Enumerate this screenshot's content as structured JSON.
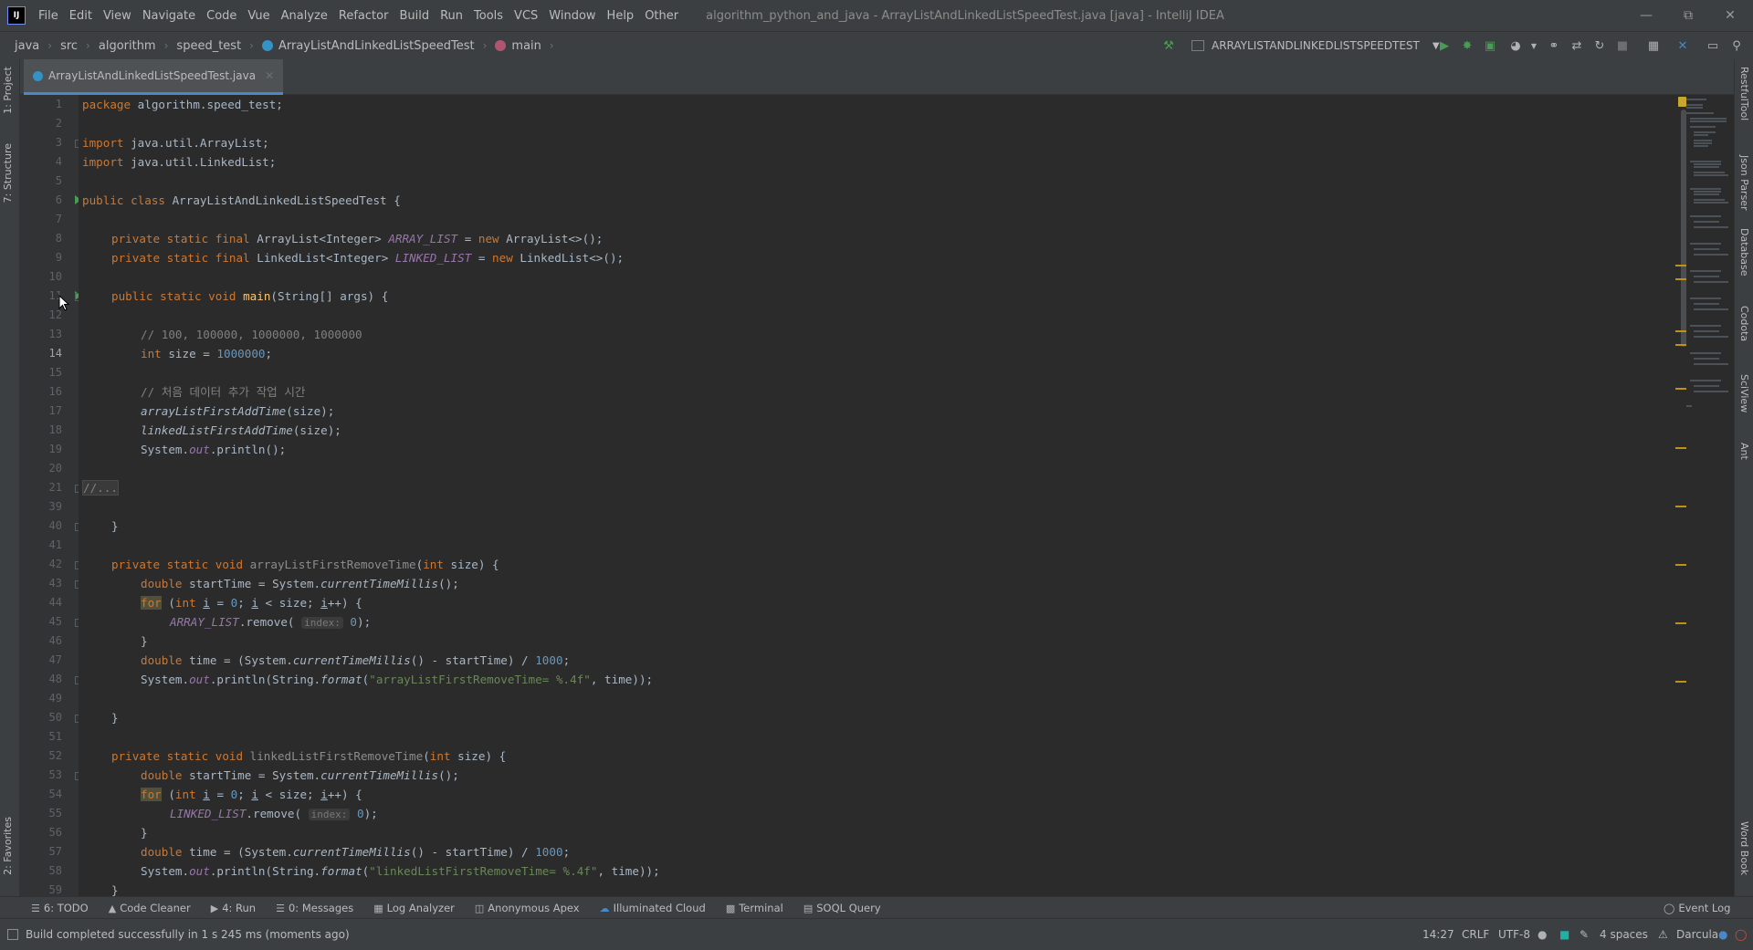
{
  "menubar": {
    "logo": "IJ",
    "items": [
      "File",
      "Edit",
      "View",
      "Navigate",
      "Code",
      "Vue",
      "Analyze",
      "Refactor",
      "Build",
      "Run",
      "Tools",
      "VCS",
      "Window",
      "Help",
      "Other"
    ],
    "window_title": "algorithm_python_and_java - ArrayListAndLinkedListSpeedTest.java [java] - IntelliJ IDEA"
  },
  "breadcrumb": {
    "items": [
      "java",
      "src",
      "algorithm",
      "speed_test",
      "ArrayListAndLinkedListSpeedTest",
      "main"
    ]
  },
  "toolbar": {
    "run_config": "ARRAYLISTANDLINKEDLISTSPEEDTEST"
  },
  "left_tabs": {
    "project": "1: Project",
    "structure": "7: Structure",
    "favorites": "2: Favorites"
  },
  "right_tabs": {
    "restful": "RestfulTool",
    "json_parser": "Json Parser",
    "database": "Database",
    "codota": "Codota",
    "sciview": "SciView",
    "ant": "Ant",
    "wordbook": "Word Book"
  },
  "editor": {
    "tab_name": "ArrayListAndLinkedListSpeedTest.java",
    "current_line": 14,
    "line_numbers": [
      "1",
      "2",
      "3",
      "4",
      "5",
      "6",
      "7",
      "8",
      "9",
      "10",
      "11",
      "12",
      "13",
      "14",
      "15",
      "16",
      "17",
      "18",
      "19",
      "20",
      "21",
      "39",
      "40",
      "41",
      "42",
      "43",
      "44",
      "45",
      "46",
      "47",
      "48",
      "49",
      "50",
      "51",
      "52",
      "53",
      "54",
      "55",
      "56",
      "57",
      "58",
      "59"
    ],
    "code": {
      "l1_kw": "package",
      "l1": " algorithm.speed_test;",
      "l3_kw": "import",
      "l3": " java.util.ArrayList;",
      "l4_kw": "import",
      "l4": " java.util.LinkedList;",
      "l6_kw": "public class",
      "l6": " ArrayListAndLinkedListSpeedTest {",
      "l8_kw": "private static final",
      "l8_type": " ArrayList<Integer> ",
      "l8_field": "ARRAY_LIST",
      "l8_eq": " = ",
      "l8_new": "new",
      "l8_rest": " ArrayList<>();",
      "l9_kw": "private static final",
      "l9_type": " LinkedList<Integer> ",
      "l9_field": "LINKED_LIST",
      "l9_eq": " = ",
      "l9_new": "new",
      "l9_rest": " LinkedList<>();",
      "l11_kw": "public static void",
      "l11_name": " main",
      "l11_rest": "(String[] args) {",
      "l13": "// 100, 100000, 1000000, 1000000",
      "l14_kw": "int",
      "l14": " size = ",
      "l14_num": "1000000",
      "l14_end": ";",
      "l16": "// 처음 데이터 추가 작업 시간",
      "l17": "arrayListFirstAddTime",
      "l17_rest": "(size);",
      "l18": "linkedListFirstAddTime",
      "l18_rest": "(size);",
      "l19_a": "System.",
      "l19_out": "out",
      "l19_b": ".println();",
      "l21": "//...",
      "l40": "}",
      "l42_kw": "private static void",
      "l42_name": " arrayListFirstRemoveTime",
      "l42_p": "(",
      "l42_int": "int",
      "l42_rest": " size) {",
      "l43_kw": "double",
      "l43_a": " startTime = System.",
      "l43_m": "currentTimeMillis",
      "l43_b": "();",
      "l44_for": "for",
      "l44_a": " (",
      "l44_int": "int",
      "l44_b": " ",
      "l44_i": "i",
      "l44_c": " = ",
      "l44_zero": "0",
      "l44_d": "; ",
      "l44_i2": "i",
      "l44_e": " < size; ",
      "l44_i3": "i",
      "l44_f": "++) {",
      "l45_field": "ARRAY_LIST",
      "l45_a": ".remove( ",
      "l45_hint": "index:",
      "l45_num": " 0",
      "l45_b": ");",
      "l46": "}",
      "l47_kw": "double",
      "l47_a": " time = (System.",
      "l47_m": "currentTimeMillis",
      "l47_b": "() - startTime) / ",
      "l47_num": "1000",
      "l47_c": ";",
      "l48_a": "System.",
      "l48_out": "out",
      "l48_b": ".println(String.",
      "l48_f": "format",
      "l48_c": "(",
      "l48_str": "\"arrayListFirstRemoveTime= %.4f\"",
      "l48_d": ", time));",
      "l50": "}",
      "l52_kw": "private static void",
      "l52_name": " linkedListFirstRemoveTime",
      "l52_p": "(",
      "l52_int": "int",
      "l52_rest": " size) {",
      "l53_kw": "double",
      "l53_a": " startTime = System.",
      "l53_m": "currentTimeMillis",
      "l53_b": "();",
      "l54_for": "for",
      "l54_a": " (",
      "l54_int": "int",
      "l54_b": " ",
      "l54_i": "i",
      "l54_c": " = ",
      "l54_zero": "0",
      "l54_d": "; ",
      "l54_i2": "i",
      "l54_e": " < size; ",
      "l54_i3": "i",
      "l54_f": "++) {",
      "l55_field": "LINKED_LIST",
      "l55_a": ".remove( ",
      "l55_hint": "index:",
      "l55_num": " 0",
      "l55_b": ");",
      "l56": "}",
      "l57_kw": "double",
      "l57_a": " time = (System.",
      "l57_m": "currentTimeMillis",
      "l57_b": "() - startTime) / ",
      "l57_num": "1000",
      "l57_c": ";",
      "l58_a": "System.",
      "l58_out": "out",
      "l58_b": ".println(String.",
      "l58_f": "format",
      "l58_c": "(",
      "l58_str": "\"linkedListFirstRemoveTime= %.4f\"",
      "l58_d": ", time));",
      "l59": "}"
    }
  },
  "bottom_tools": [
    "6: TODO",
    "Code Cleaner",
    "4: Run",
    "0: Messages",
    "Log Analyzer",
    "Anonymous Apex",
    "Illuminated Cloud",
    "Terminal",
    "SOQL Query"
  ],
  "event_log": "Event Log",
  "status": {
    "message": "Build completed successfully in 1 s 245 ms (moments ago)",
    "position": "14:27",
    "line_sep": "CRLF",
    "encoding": "UTF-8",
    "indent": "4 spaces",
    "theme": "Darcula"
  },
  "colors": {
    "keyword": "#cc7832",
    "comment": "#808080",
    "number": "#6897bb",
    "string": "#6a8759",
    "static_field": "#9876aa",
    "method_decl": "#ffc66d"
  }
}
